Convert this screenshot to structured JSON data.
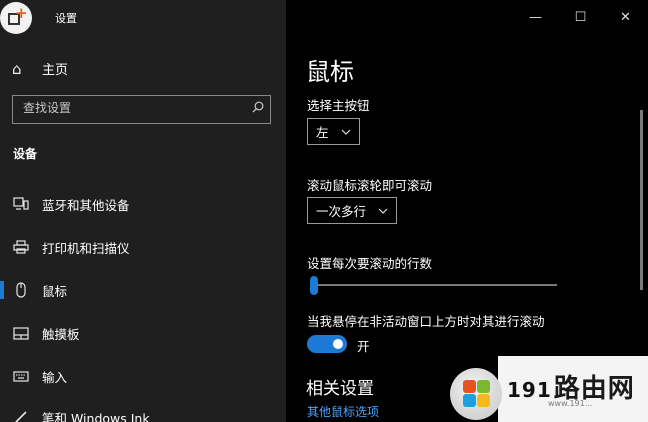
{
  "window": {
    "title": "设置",
    "controls": {
      "minimize": "—",
      "maximize": "☐",
      "close": "✕"
    }
  },
  "sidebar": {
    "home_label": "主页",
    "search_placeholder": "查找设置",
    "section_title": "设备",
    "items": [
      {
        "label": "蓝牙和其他设备",
        "icon": "bluetooth-devices-icon"
      },
      {
        "label": "打印机和扫描仪",
        "icon": "printer-icon"
      },
      {
        "label": "鼠标",
        "icon": "mouse-icon",
        "active": true
      },
      {
        "label": "触摸板",
        "icon": "touchpad-icon"
      },
      {
        "label": "输入",
        "icon": "keyboard-icon"
      },
      {
        "label": "笔和 Windows Ink",
        "icon": "pen-icon"
      }
    ]
  },
  "main": {
    "page_title": "鼠标",
    "primary_button": {
      "label": "选择主按钮",
      "value": "左"
    },
    "wheel_scroll": {
      "label": "滚动鼠标滚轮即可滚动",
      "value": "一次多行"
    },
    "lines_to_scroll": {
      "label": "设置每次要滚动的行数",
      "level_fraction": 0.02
    },
    "inactive_scroll": {
      "label": "当我悬停在非活动窗口上方时对其进行滚动",
      "state": "开",
      "on": true
    },
    "related": {
      "title": "相关设置",
      "link": "其他鼠标选项"
    }
  },
  "watermark": {
    "number": "191",
    "text": "路由网",
    "url": "www.191..."
  },
  "colors": {
    "accent": "#1c7ad4",
    "sidebar_bg": "#1f1f1f",
    "main_bg": "#000000",
    "link": "#4aa3ff"
  }
}
